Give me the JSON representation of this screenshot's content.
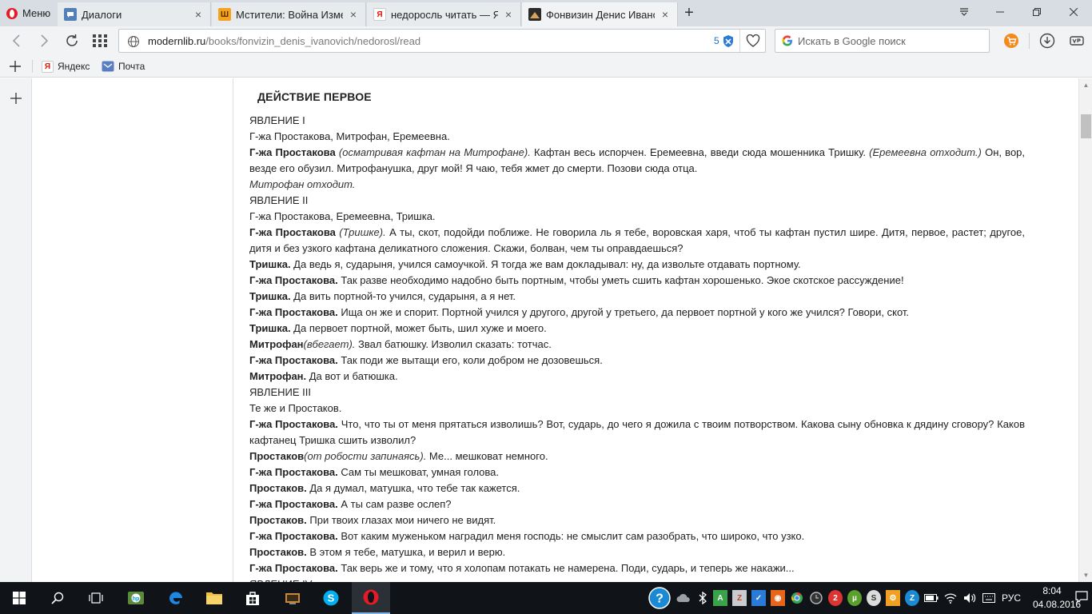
{
  "browser": {
    "menu_label": "Меню",
    "tabs": [
      {
        "title": "Диалоги",
        "favicon": "vk-icon",
        "color": "#5181b8",
        "active": false
      },
      {
        "title": "Мстители: Война Измерений",
        "favicon": "comics-icon",
        "color": "#f6a21c",
        "active": false
      },
      {
        "title": "недоросль читать — Яндекс",
        "favicon": "yandex-icon",
        "color": "#ffffff",
        "active": false
      },
      {
        "title": "Фонвизин Денис Иванович",
        "favicon": "modernlib-icon",
        "color": "#2b2b2b",
        "active": true
      }
    ],
    "url_host": "modernlib.ru",
    "url_path": "/books/fonvizin_denis_ivanovich/nedorosl/read",
    "badge_count": "5",
    "search_placeholder": "Искать в Google поиск",
    "bookmarks": [
      {
        "label": "Яндекс",
        "icon": "yandex-icon"
      },
      {
        "label": "Почта",
        "icon": "mail-icon"
      }
    ]
  },
  "page": {
    "act_title": "ДЕЙСТВИЕ ПЕРВОЕ",
    "lines": [
      {
        "segments": [
          {
            "t": "ЯВЛЕНИЕ I",
            "s": "n"
          }
        ]
      },
      {
        "segments": [
          {
            "t": "Г-жа Простакова, Митрофан, Еремеевна.",
            "s": "n"
          }
        ]
      },
      {
        "segments": [
          {
            "t": "Г-жа Простакова",
            "s": "b"
          },
          {
            "t": " ",
            "s": "n"
          },
          {
            "t": "(осматривая кафтан на Митрофане).",
            "s": "i"
          },
          {
            "t": " Кафтан весь испорчен. Еремеевна, введи сюда мошенника Тришку. ",
            "s": "n"
          },
          {
            "t": "(Еремеевна отходит.)",
            "s": "i"
          },
          {
            "t": " Он, вор, везде его обузил. Митрофанушка, друг мой! Я чаю, тебя жмет до смерти. Позови сюда отца.",
            "s": "n"
          }
        ]
      },
      {
        "segments": [
          {
            "t": "Митрофан отходит.",
            "s": "i"
          }
        ]
      },
      {
        "segments": [
          {
            "t": "ЯВЛЕНИЕ II",
            "s": "n"
          }
        ]
      },
      {
        "segments": [
          {
            "t": "Г-жа Простакова, Еремеевна, Тришка.",
            "s": "n"
          }
        ]
      },
      {
        "segments": [
          {
            "t": "Г-жа Простакова",
            "s": "b"
          },
          {
            "t": " ",
            "s": "n"
          },
          {
            "t": "(Тришке).",
            "s": "i"
          },
          {
            "t": " А ты, скот, подойди поближе. Не говорила ль я тебе, воровская харя, чтоб ты кафтан пустил шире. Дитя, первое, растет; другое, дитя и без узкого кафтана деликатного сложения. Скажи, болван, чем ты оправдаешься?",
            "s": "n"
          }
        ]
      },
      {
        "segments": [
          {
            "t": "Тришка.",
            "s": "b"
          },
          {
            "t": " Да ведь я, сударыня, учился самоучкой. Я тогда же вам докладывал: ну, да извольте отдавать портному.",
            "s": "n"
          }
        ]
      },
      {
        "segments": [
          {
            "t": "Г-жа Простакова.",
            "s": "b"
          },
          {
            "t": " Так разве необходимо надобно быть портным, чтобы уметь сшить кафтан хорошенько. Экое скотское рассуждение!",
            "s": "n"
          }
        ]
      },
      {
        "segments": [
          {
            "t": "Тришка.",
            "s": "b"
          },
          {
            "t": " Да вить портной-то учился, сударыня, а я нет.",
            "s": "n"
          }
        ]
      },
      {
        "segments": [
          {
            "t": "Г-жа Простакова.",
            "s": "b"
          },
          {
            "t": " Ища он же и спорит. Портной учился у другого, другой у третьего, да первоет портной у кого же учился? Говори, скот.",
            "s": "n"
          }
        ]
      },
      {
        "segments": [
          {
            "t": "Тришка.",
            "s": "b"
          },
          {
            "t": " Да первоет портной, может быть, шил хуже и моего.",
            "s": "n"
          }
        ]
      },
      {
        "segments": [
          {
            "t": "Митрофан",
            "s": "b"
          },
          {
            "t": "(вбегает).",
            "s": "i"
          },
          {
            "t": " Звал батюшку. Изволил сказать: тотчас.",
            "s": "n"
          }
        ]
      },
      {
        "segments": [
          {
            "t": "Г-жа Простакова.",
            "s": "b"
          },
          {
            "t": " Так поди же вытащи его, коли добром не дозовешься.",
            "s": "n"
          }
        ]
      },
      {
        "segments": [
          {
            "t": "Митрофан.",
            "s": "b"
          },
          {
            "t": " Да вот и батюшка.",
            "s": "n"
          }
        ]
      },
      {
        "segments": [
          {
            "t": "ЯВЛЕНИЕ III",
            "s": "n"
          }
        ]
      },
      {
        "segments": [
          {
            "t": "Те же и Простаков.",
            "s": "n"
          }
        ]
      },
      {
        "segments": [
          {
            "t": "Г-жа Простакова.",
            "s": "b"
          },
          {
            "t": " Что, что ты от меня прятаться изволишь? Вот, сударь, до чего я дожила с твоим потворством. Какова сыну обновка к дядину сговору? Каков кафтанец Тришка сшить изволил?",
            "s": "n"
          }
        ]
      },
      {
        "segments": [
          {
            "t": "Простаков",
            "s": "b"
          },
          {
            "t": "(от робости запинаясь).",
            "s": "i"
          },
          {
            "t": " Ме... мешковат немного.",
            "s": "n"
          }
        ]
      },
      {
        "segments": [
          {
            "t": "Г-жа Простакова.",
            "s": "b"
          },
          {
            "t": " Сам ты мешковат, умная голова.",
            "s": "n"
          }
        ]
      },
      {
        "segments": [
          {
            "t": "Простаков.",
            "s": "b"
          },
          {
            "t": " Да я думал, матушка, что тебе так кажется.",
            "s": "n"
          }
        ]
      },
      {
        "segments": [
          {
            "t": "Г-жа Простакова.",
            "s": "b"
          },
          {
            "t": " А ты сам разве ослеп?",
            "s": "n"
          }
        ]
      },
      {
        "segments": [
          {
            "t": "Простаков.",
            "s": "b"
          },
          {
            "t": " При твоих глазах мои ничего не видят.",
            "s": "n"
          }
        ]
      },
      {
        "segments": [
          {
            "t": "Г-жа Простакова.",
            "s": "b"
          },
          {
            "t": " Вот каким муженьком наградил меня господь: не смыслит сам разобрать, что широко, что узко.",
            "s": "n"
          }
        ]
      },
      {
        "segments": [
          {
            "t": "Простаков.",
            "s": "b"
          },
          {
            "t": " В этом я тебе, матушка, и верил и верю.",
            "s": "n"
          }
        ]
      },
      {
        "segments": [
          {
            "t": "Г-жа Простакова.",
            "s": "b"
          },
          {
            "t": " Так верь же и тому, что я холопам потакать не намерена. Поди, сударь, и теперь же накажи...",
            "s": "n"
          }
        ]
      },
      {
        "segments": [
          {
            "t": "ЯВЛЕНИЕ IV",
            "s": "n"
          }
        ]
      }
    ]
  },
  "taskbar": {
    "language": "РУС",
    "time": "8:04",
    "date": "04.08.2016",
    "pinned": [
      "start-icon",
      "search-icon",
      "task-view-icon",
      "hp-icon",
      "edge-icon",
      "explorer-icon",
      "store-icon",
      "app-icon",
      "skype-icon",
      "opera-icon"
    ],
    "colors": {
      "skype": "#00aff0",
      "opera": "#e21c27",
      "edge": "#1e88e5",
      "explorer": "#f3c23c"
    }
  }
}
